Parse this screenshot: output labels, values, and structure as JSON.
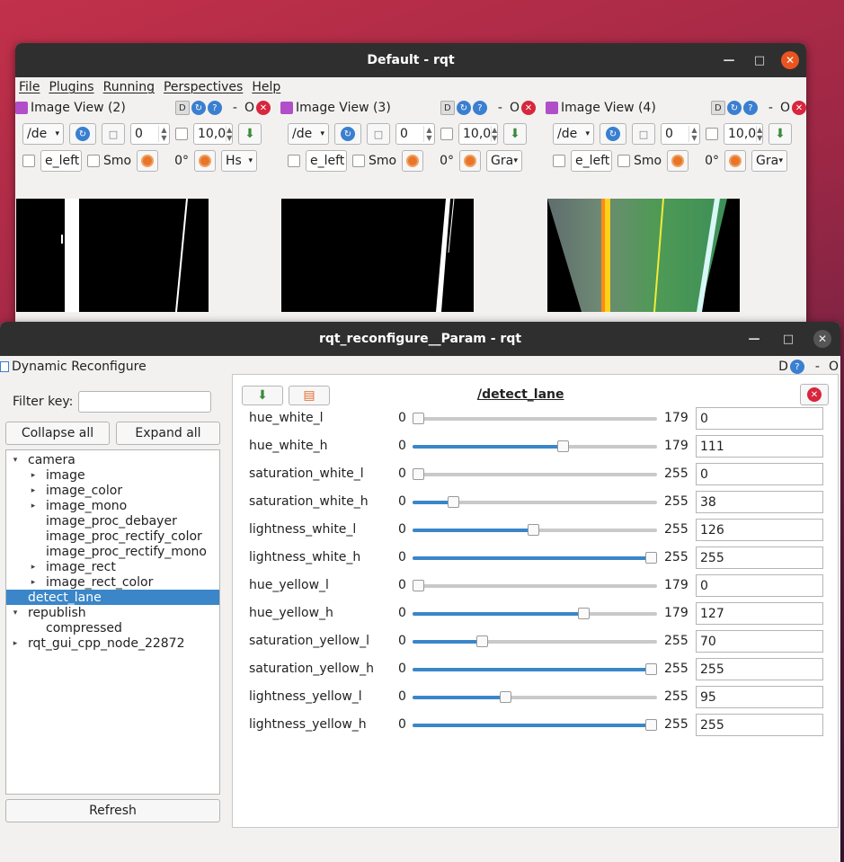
{
  "win1": {
    "title": "Default - rqt",
    "menu": [
      "File",
      "Plugins",
      "Running",
      "Perspectives",
      "Help"
    ],
    "panes": [
      {
        "title": "Image View (2)",
        "topic": "/de",
        "spin1": "0",
        "spin2": "10,0",
        "name": "e_left",
        "smooth": "Smo",
        "rot": "0°",
        "mode": "Hs"
      },
      {
        "title": "Image View (3)",
        "topic": "/de",
        "spin1": "0",
        "spin2": "10,0",
        "name": "e_left",
        "smooth": "Smo",
        "rot": "0°",
        "mode": "Gra"
      },
      {
        "title": "Image View (4)",
        "topic": "/de",
        "spin1": "0",
        "spin2": "10,0",
        "name": "e_left",
        "smooth": "Smo",
        "rot": "0°",
        "mode": "Gra"
      }
    ],
    "head_labels": {
      "d": "D",
      "dash": "-",
      "o": "O"
    }
  },
  "win2": {
    "title": "rqt_reconfigure__Param - rqt",
    "plugin_title": "Dynamic Reconfigure",
    "head_labels": {
      "d": "D",
      "dash": "-",
      "o": "O"
    },
    "filter_label": "Filter key:",
    "collapse_label": "Collapse all",
    "expand_label": "Expand all",
    "refresh_label": "Refresh",
    "node_title": "/detect_lane",
    "tree": [
      {
        "label": "camera",
        "level": 0,
        "arrow": "▾"
      },
      {
        "label": "image",
        "level": 1,
        "arrow": "▸"
      },
      {
        "label": "image_color",
        "level": 1,
        "arrow": "▸"
      },
      {
        "label": "image_mono",
        "level": 1,
        "arrow": "▸"
      },
      {
        "label": "image_proc_debayer",
        "level": 1,
        "arrow": ""
      },
      {
        "label": "image_proc_rectify_color",
        "level": 1,
        "arrow": ""
      },
      {
        "label": "image_proc_rectify_mono",
        "level": 1,
        "arrow": ""
      },
      {
        "label": "image_rect",
        "level": 1,
        "arrow": "▸"
      },
      {
        "label": "image_rect_color",
        "level": 1,
        "arrow": "▸"
      },
      {
        "label": "detect_lane",
        "level": 0,
        "arrow": "",
        "selected": true
      },
      {
        "label": "republish",
        "level": 0,
        "arrow": "▾"
      },
      {
        "label": "compressed",
        "level": 1,
        "arrow": ""
      },
      {
        "label": "rqt_gui_cpp_node_22872",
        "level": 0,
        "arrow": "▸"
      }
    ],
    "params": [
      {
        "name": "hue_white_l",
        "min": "0",
        "max": "179",
        "value": "0",
        "fraction": 0.0
      },
      {
        "name": "hue_white_h",
        "min": "0",
        "max": "179",
        "value": "111",
        "fraction": 0.62
      },
      {
        "name": "saturation_white_l",
        "min": "0",
        "max": "255",
        "value": "0",
        "fraction": 0.0
      },
      {
        "name": "saturation_white_h",
        "min": "0",
        "max": "255",
        "value": "38",
        "fraction": 0.149
      },
      {
        "name": "lightness_white_l",
        "min": "0",
        "max": "255",
        "value": "126",
        "fraction": 0.494
      },
      {
        "name": "lightness_white_h",
        "min": "0",
        "max": "255",
        "value": "255",
        "fraction": 1.0
      },
      {
        "name": "hue_yellow_l",
        "min": "0",
        "max": "179",
        "value": "0",
        "fraction": 0.0
      },
      {
        "name": "hue_yellow_h",
        "min": "0",
        "max": "179",
        "value": "127",
        "fraction": 0.709
      },
      {
        "name": "saturation_yellow_l",
        "min": "0",
        "max": "255",
        "value": "70",
        "fraction": 0.275
      },
      {
        "name": "saturation_yellow_h",
        "min": "0",
        "max": "255",
        "value": "255",
        "fraction": 1.0
      },
      {
        "name": "lightness_yellow_l",
        "min": "0",
        "max": "255",
        "value": "95",
        "fraction": 0.373
      },
      {
        "name": "lightness_yellow_h",
        "min": "0",
        "max": "255",
        "value": "255",
        "fraction": 1.0
      }
    ]
  }
}
